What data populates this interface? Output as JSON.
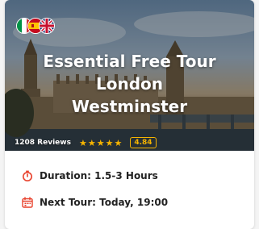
{
  "tour": {
    "title_lines": [
      "Essential Free Tour",
      "London",
      "Westminster"
    ],
    "reviews": "1208 Reviews",
    "rating": "4.84",
    "rating_value": 4.84,
    "stars_max": 5,
    "languages": [
      "Italian",
      "Spanish",
      "English"
    ],
    "duration": "Duration:  1.5-3 Hours",
    "next_tour": "Next Tour: Today, 19:00"
  },
  "icons": {
    "duration": "stopwatch-icon",
    "next_tour": "calendar-icon"
  },
  "colors": {
    "accent": "#e8412c",
    "star": "#f5b400"
  }
}
